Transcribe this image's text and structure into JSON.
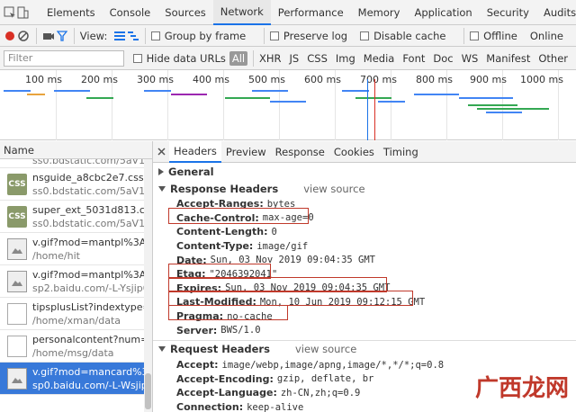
{
  "toolbar": {
    "tabs": [
      "Elements",
      "Console",
      "Sources",
      "Network",
      "Performance",
      "Memory",
      "Application",
      "Security",
      "Audits"
    ],
    "active_tab": "Network"
  },
  "network_bar": {
    "view_label": "View:",
    "group_by_frame": "Group by frame",
    "preserve_log": "Preserve log",
    "disable_cache": "Disable cache",
    "offline": "Offline",
    "online": "Online"
  },
  "filter_bar": {
    "placeholder": "Filter",
    "hide_data_urls": "Hide data URLs",
    "types": [
      "All",
      "XHR",
      "JS",
      "CSS",
      "Img",
      "Media",
      "Font",
      "Doc",
      "WS",
      "Manifest",
      "Other"
    ]
  },
  "timeline": {
    "ticks": [
      "100 ms",
      "200 ms",
      "300 ms",
      "400 ms",
      "500 ms",
      "600 ms",
      "700 ms",
      "800 ms",
      "900 ms",
      "1000 ms"
    ]
  },
  "requests": {
    "header": "Name",
    "items": [
      {
        "name": "ss0.bdstatic.com/5aV1bj",
        "path": "",
        "icon": "css"
      },
      {
        "name": "nsguide_a8cbc2e7.css",
        "path": "ss0.bdstatic.com/5aV1bj",
        "icon": "css"
      },
      {
        "name": "super_ext_5031d813.css",
        "path": "ss0.bdstatic.com/5aV1bj",
        "icon": "css"
      },
      {
        "name": "v.gif?mod=mantpl%3Ar",
        "path": "/home/hit",
        "icon": "img"
      },
      {
        "name": "v.gif?mod=mantpl%3Ar",
        "path": "sp2.baidu.com/-L-Ysjip0",
        "icon": "img"
      },
      {
        "name": "tipsplusList?indextype=...",
        "path": "/home/xman/data",
        "icon": "doc"
      },
      {
        "name": "personalcontent?num=...",
        "path": "/home/msg/data",
        "icon": "doc"
      },
      {
        "name": "v.gif?mod=mancard%3...",
        "path": "sp0.baidu.com/-L-Wsjip",
        "icon": "img"
      }
    ]
  },
  "detail": {
    "tabs": [
      "Headers",
      "Preview",
      "Response",
      "Cookies",
      "Timing"
    ],
    "active_tab": "Headers",
    "general_label": "General",
    "response_headers_label": "Response Headers",
    "request_headers_label": "Request Headers",
    "view_source": "view source",
    "response_headers": [
      {
        "key": "Accept-Ranges:",
        "value": "bytes"
      },
      {
        "key": "Cache-Control:",
        "value": "max-age=0"
      },
      {
        "key": "Content-Length:",
        "value": "0"
      },
      {
        "key": "Content-Type:",
        "value": "image/gif"
      },
      {
        "key": "Date:",
        "value": "Sun, 03 Nov 2019 09:04:35 GMT"
      },
      {
        "key": "Etag:",
        "value": "\"2046392041\""
      },
      {
        "key": "Expires:",
        "value": "Sun, 03 Nov 2019 09:04:35 GMT"
      },
      {
        "key": "Last-Modified:",
        "value": "Mon, 10 Jun 2019 09:12:15 GMT"
      },
      {
        "key": "Pragma:",
        "value": "no-cache"
      },
      {
        "key": "Server:",
        "value": "BWS/1.0"
      }
    ],
    "request_headers": [
      {
        "key": "Accept:",
        "value": "image/webp,image/apng,image/*,*/*;q=0.8"
      },
      {
        "key": "Accept-Encoding:",
        "value": "gzip, deflate, br"
      },
      {
        "key": "Accept-Language:",
        "value": "zh-CN,zh;q=0.9"
      },
      {
        "key": "Connection:",
        "value": "keep-alive"
      }
    ]
  },
  "watermark": "广西龙网",
  "colors": {
    "accent": "#1a73e8",
    "highlight_box": "#c0392b",
    "selected_row": "#3879d9"
  }
}
